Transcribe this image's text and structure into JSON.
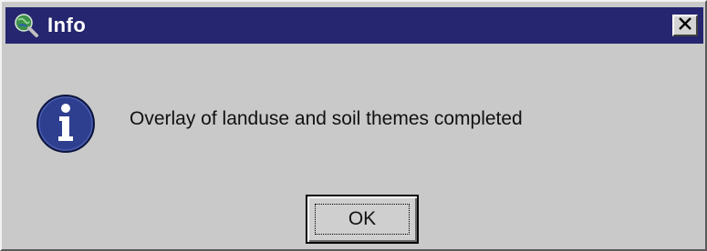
{
  "window": {
    "title": "Info",
    "title_icon": "globe-magnifier-icon",
    "close_icon": "close-icon",
    "colors": {
      "titlebar": "#25266f",
      "title_text": "#ffffff",
      "dialog_bg": "#c9c9c9",
      "info_icon": "#2e3f8f"
    }
  },
  "message": {
    "icon": "info-icon",
    "text": "Overlay of landuse and soil themes completed"
  },
  "buttons": {
    "ok_label": "OK"
  }
}
